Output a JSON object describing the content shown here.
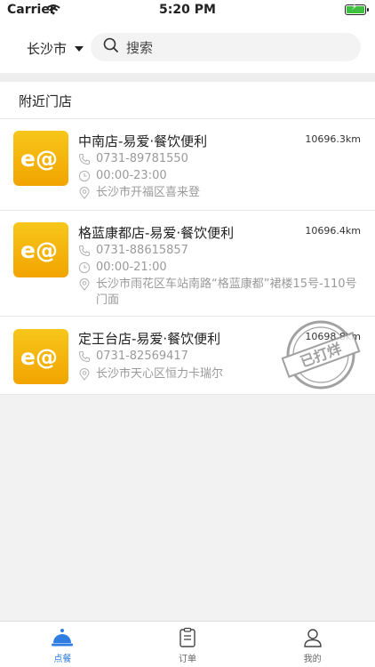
{
  "status_bar": {
    "carrier": "Carrier",
    "time": "5:20 PM"
  },
  "header": {
    "city": "长沙市",
    "search_placeholder": "搜索"
  },
  "section_title": "附近门店",
  "stores": [
    {
      "name": "中南店-易爱·餐饮便利",
      "distance": "10696.3km",
      "phone": "0731-89781550",
      "hours": "00:00-23:00",
      "address": "长沙市开福区喜来登"
    },
    {
      "name": "格蓝康都店-易爱·餐饮便利",
      "distance": "10696.4km",
      "phone": "0731-88615857",
      "hours": "00:00-21:00",
      "address": "长沙市雨花区车站南路“格蓝康都”裙楼15号-110号门面"
    },
    {
      "name": "定王台店-易爱·餐饮便利",
      "distance": "10698.8km",
      "phone": "0731-82569417",
      "address": "长沙市天心区恒力卡瑞尔",
      "stamp": "已打烊"
    }
  ],
  "tabbar": {
    "items": [
      {
        "label": "点餐"
      },
      {
        "label": "订单"
      },
      {
        "label": "我的"
      }
    ]
  },
  "colors": {
    "accent": "#2f7de1",
    "logo": "#f5b50c"
  }
}
